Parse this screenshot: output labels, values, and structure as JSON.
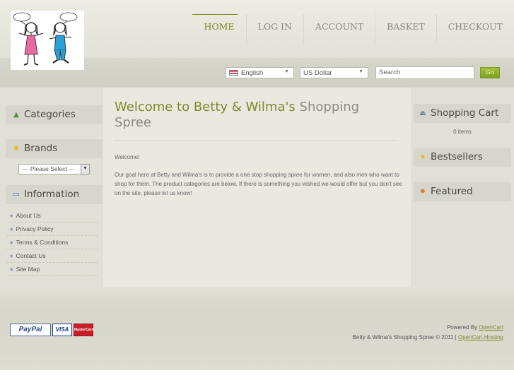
{
  "nav": {
    "items": [
      {
        "label": "HOME",
        "active": true
      },
      {
        "label": "LOG IN"
      },
      {
        "label": "ACCOUNT"
      },
      {
        "label": "BASKET"
      },
      {
        "label": "CHECKOUT"
      }
    ]
  },
  "toolbar": {
    "language": "English",
    "currency": "US Dollar",
    "search_placeholder": "Search",
    "go_label": "Go"
  },
  "left": {
    "categories_title": "Categories",
    "brands_title": "Brands",
    "brands_select": "--- Please Select ---",
    "information_title": "Information",
    "info_links": [
      "About Us",
      "Privacy Policy",
      "Terms & Conditions",
      "Contact Us",
      "Site Map"
    ]
  },
  "main": {
    "title_part1": "Welcome to Betty & Wilma's ",
    "title_part2": "Shopping Spree",
    "welcome": "Welcome!",
    "body": "Our goal here at Betty and Wilma's is to provide a one stop shopping spree for women, and also men who want to shop for them. The product categories are below.  If there is something you wished we would offer but you don't see on the site, please let us know!"
  },
  "right": {
    "cart_title": "Shopping Cart",
    "cart_items": "0 items",
    "bestsellers_title": "Bestsellers",
    "featured_title": "Featured"
  },
  "footer": {
    "cards": [
      "PayPal",
      "VISA",
      "MasterCard"
    ],
    "powered_by": "Powered By ",
    "opencart": "OpenCart",
    "copyright": "Betty & Wilma's Shopping Spree © 2011 | ",
    "hosting": "OpenCart Hosting"
  },
  "colors": {
    "accent": "#7b8a2b",
    "background": "#e8e8df",
    "text": "#555555"
  }
}
